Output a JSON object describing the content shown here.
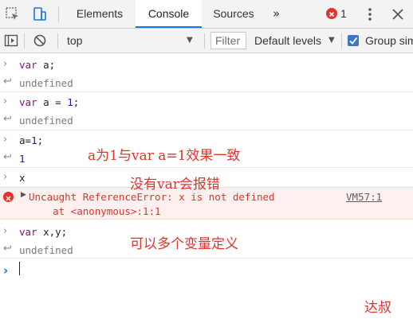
{
  "tabbar": {
    "tabs": [
      {
        "label": "Elements"
      },
      {
        "label": "Console"
      },
      {
        "label": "Sources"
      }
    ],
    "more": "»",
    "error_count": "1",
    "icons": [
      "inspect-icon",
      "device-toggle-icon",
      "error-icon",
      "kebab-menu-icon",
      "close-icon"
    ]
  },
  "toolbar": {
    "context": "top",
    "filter_placeholder": "Filter",
    "levels": "Default levels",
    "group_label": "Group similar",
    "group_checked": true,
    "icons": [
      "sidebar-toggle-icon",
      "clear-console-icon",
      "dropdown-arrow-icon"
    ]
  },
  "console": {
    "lines": [
      {
        "kind": "input",
        "text": "var a;"
      },
      {
        "kind": "result",
        "text": "undefined"
      },
      {
        "kind": "input",
        "text": "var a = 1;"
      },
      {
        "kind": "result",
        "text": "undefined"
      },
      {
        "kind": "input",
        "text": "a=1;"
      },
      {
        "kind": "result",
        "text": "1"
      },
      {
        "kind": "input",
        "text": "x"
      },
      {
        "kind": "error",
        "text": "Uncaught ReferenceError: x is not defined",
        "trace": "    at <anonymous>:1:1",
        "source": "VM57:1"
      },
      {
        "kind": "input",
        "text": "var x,y;"
      },
      {
        "kind": "result",
        "text": "undefined"
      }
    ]
  },
  "annotations": {
    "note1": "a为1与var a=1效果一致",
    "note2": "没有var会报错",
    "note3": "可以多个变量定义",
    "signature": "达叔"
  },
  "colors": {
    "accent": "#1a73e8",
    "error": "#e0342b",
    "keyword": "#881280",
    "number": "#1a1aa6"
  }
}
